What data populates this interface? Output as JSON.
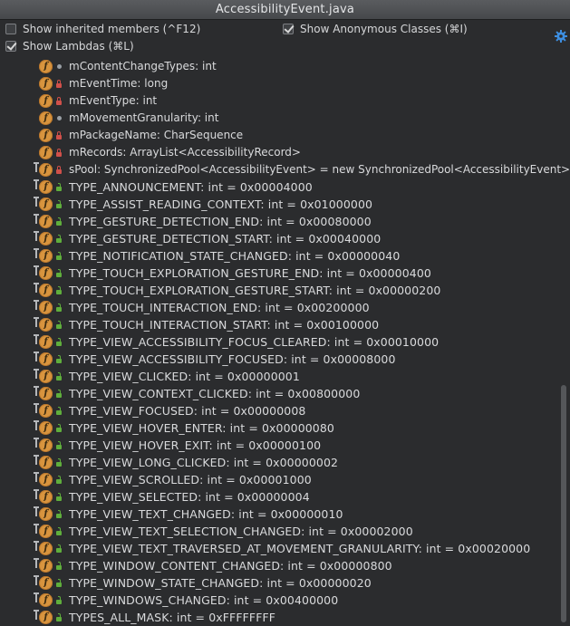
{
  "window": {
    "title": "AccessibilityEvent.java"
  },
  "options": {
    "inherited_label": "Show inherited members (^F12)",
    "inherited_checked": false,
    "anonymous_label": "Show Anonymous Classes (⌘I)",
    "anonymous_checked": true,
    "lambdas_label": "Show Lambdas (⌘L)",
    "lambdas_checked": true
  },
  "icons": {
    "field": "field-icon-f",
    "final": "final-pin-icon",
    "settings": "gear-icon"
  },
  "colors": {
    "background": "#2b2c2e",
    "field_icon": "#d8943e",
    "private_lock": "#d0504a",
    "public_lock": "#5fae3c",
    "package_dot": "#9aa0a6"
  },
  "members": [
    {
      "text": "mContentChangeTypes: int",
      "visibility": "package",
      "final": false
    },
    {
      "text": "mEventTime: long",
      "visibility": "private",
      "final": false
    },
    {
      "text": "mEventType: int",
      "visibility": "private",
      "final": false
    },
    {
      "text": "mMovementGranularity: int",
      "visibility": "package",
      "final": false
    },
    {
      "text": "mPackageName: CharSequence",
      "visibility": "private",
      "final": false
    },
    {
      "text": "mRecords: ArrayList<AccessibilityRecord>",
      "visibility": "private",
      "final": false
    },
    {
      "text": "sPool: SynchronizedPool<AccessibilityEvent> = new SynchronizedPool<AccessibilityEvent>(...)",
      "visibility": "private",
      "final": true
    },
    {
      "text": "TYPE_ANNOUNCEMENT: int = 0x00004000",
      "visibility": "public",
      "final": true
    },
    {
      "text": "TYPE_ASSIST_READING_CONTEXT: int = 0x01000000",
      "visibility": "public",
      "final": true
    },
    {
      "text": "TYPE_GESTURE_DETECTION_END: int = 0x00080000",
      "visibility": "public",
      "final": true
    },
    {
      "text": "TYPE_GESTURE_DETECTION_START: int = 0x00040000",
      "visibility": "public",
      "final": true
    },
    {
      "text": "TYPE_NOTIFICATION_STATE_CHANGED: int = 0x00000040",
      "visibility": "public",
      "final": true
    },
    {
      "text": "TYPE_TOUCH_EXPLORATION_GESTURE_END: int = 0x00000400",
      "visibility": "public",
      "final": true
    },
    {
      "text": "TYPE_TOUCH_EXPLORATION_GESTURE_START: int = 0x00000200",
      "visibility": "public",
      "final": true
    },
    {
      "text": "TYPE_TOUCH_INTERACTION_END: int = 0x00200000",
      "visibility": "public",
      "final": true
    },
    {
      "text": "TYPE_TOUCH_INTERACTION_START: int = 0x00100000",
      "visibility": "public",
      "final": true
    },
    {
      "text": "TYPE_VIEW_ACCESSIBILITY_FOCUS_CLEARED: int = 0x00010000",
      "visibility": "public",
      "final": true
    },
    {
      "text": "TYPE_VIEW_ACCESSIBILITY_FOCUSED: int = 0x00008000",
      "visibility": "public",
      "final": true
    },
    {
      "text": "TYPE_VIEW_CLICKED: int = 0x00000001",
      "visibility": "public",
      "final": true
    },
    {
      "text": "TYPE_VIEW_CONTEXT_CLICKED: int = 0x00800000",
      "visibility": "public",
      "final": true
    },
    {
      "text": "TYPE_VIEW_FOCUSED: int = 0x00000008",
      "visibility": "public",
      "final": true
    },
    {
      "text": "TYPE_VIEW_HOVER_ENTER: int = 0x00000080",
      "visibility": "public",
      "final": true
    },
    {
      "text": "TYPE_VIEW_HOVER_EXIT: int = 0x00000100",
      "visibility": "public",
      "final": true
    },
    {
      "text": "TYPE_VIEW_LONG_CLICKED: int = 0x00000002",
      "visibility": "public",
      "final": true
    },
    {
      "text": "TYPE_VIEW_SCROLLED: int = 0x00001000",
      "visibility": "public",
      "final": true
    },
    {
      "text": "TYPE_VIEW_SELECTED: int = 0x00000004",
      "visibility": "public",
      "final": true
    },
    {
      "text": "TYPE_VIEW_TEXT_CHANGED: int = 0x00000010",
      "visibility": "public",
      "final": true
    },
    {
      "text": "TYPE_VIEW_TEXT_SELECTION_CHANGED: int = 0x00002000",
      "visibility": "public",
      "final": true
    },
    {
      "text": "TYPE_VIEW_TEXT_TRAVERSED_AT_MOVEMENT_GRANULARITY: int = 0x00020000",
      "visibility": "public",
      "final": true
    },
    {
      "text": "TYPE_WINDOW_CONTENT_CHANGED: int = 0x00000800",
      "visibility": "public",
      "final": true
    },
    {
      "text": "TYPE_WINDOW_STATE_CHANGED: int = 0x00000020",
      "visibility": "public",
      "final": true
    },
    {
      "text": "TYPE_WINDOWS_CHANGED: int = 0x00400000",
      "visibility": "public",
      "final": true
    },
    {
      "text": "TYPES_ALL_MASK: int = 0xFFFFFFFF",
      "visibility": "public",
      "final": true
    }
  ]
}
